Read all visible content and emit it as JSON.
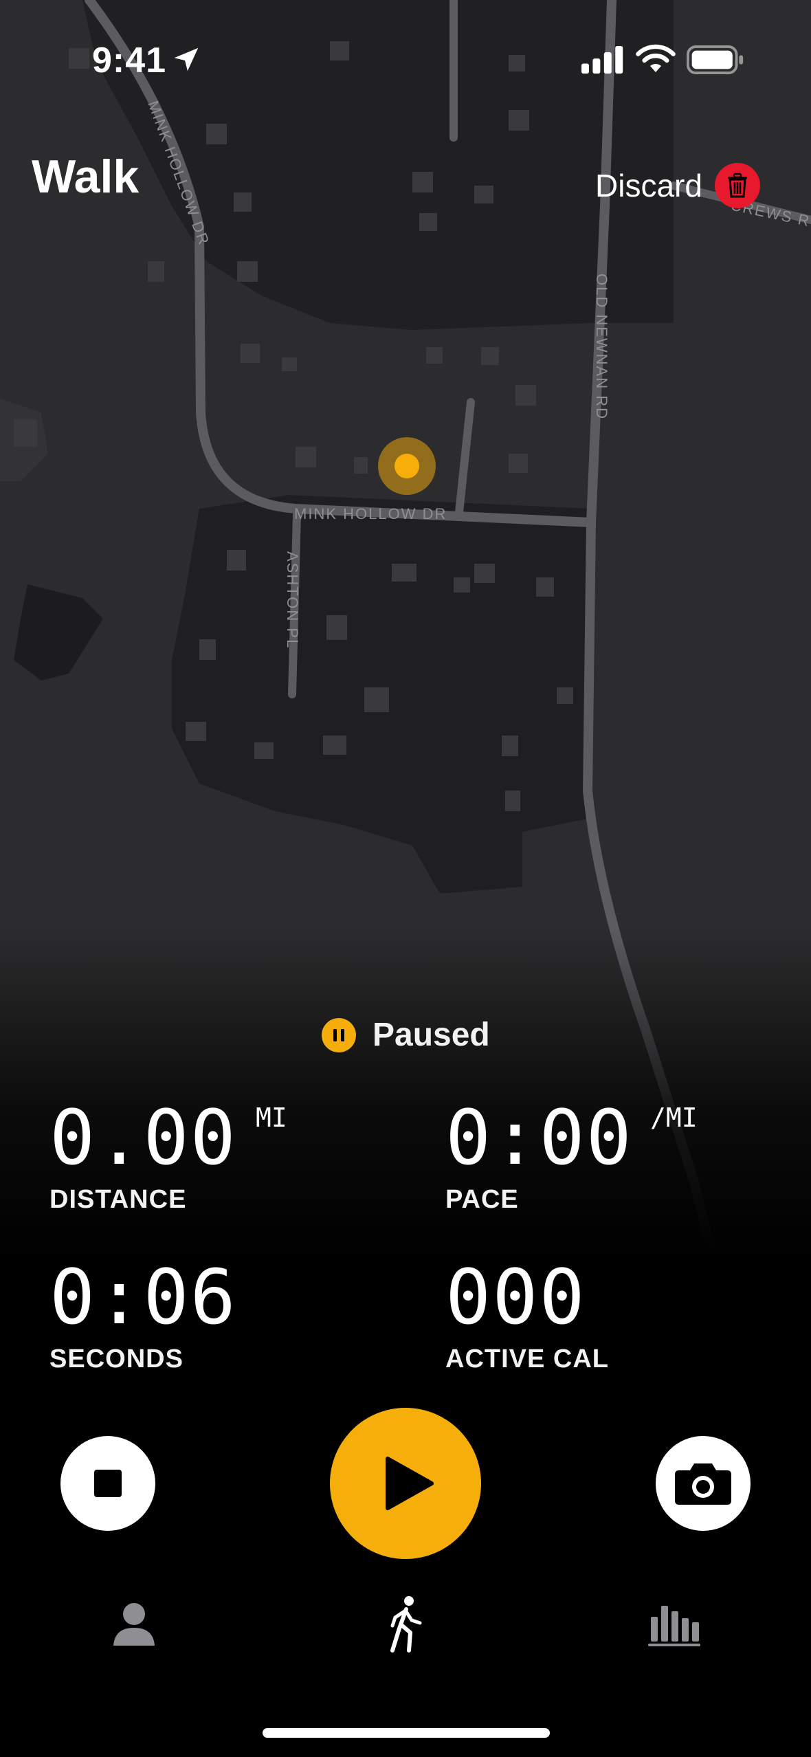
{
  "status_bar": {
    "time": "9:41"
  },
  "header": {
    "title": "Walk",
    "discard_label": "Discard"
  },
  "map": {
    "streets": [
      "MINK HOLLOW DR",
      "MINK HOLLOW DR",
      "ASHTON PL",
      "OLD NEWNAN RD",
      "CREWS R"
    ]
  },
  "workout": {
    "state_label": "Paused",
    "metrics": [
      {
        "value": "0.00",
        "unit": "MI",
        "label": "DISTANCE"
      },
      {
        "value": "0:00",
        "unit": "/MI",
        "label": "PACE"
      },
      {
        "value": "0:06",
        "unit": "",
        "label": "SECONDS"
      },
      {
        "value": "000",
        "unit": "",
        "label": "ACTIVE CAL"
      }
    ]
  },
  "controls": {
    "stop_icon": "stop-icon",
    "play_icon": "play-icon",
    "camera_icon": "camera-icon"
  },
  "tab_bar": {
    "items": [
      {
        "icon": "person-icon",
        "active": false
      },
      {
        "icon": "walking-icon",
        "active": true
      },
      {
        "icon": "chart-icon",
        "active": false
      }
    ]
  },
  "colors": {
    "accent": "#f6ae0a",
    "discard": "#e8192c",
    "map_land": "#2d2d2f",
    "map_block": "#1f1f21",
    "map_road": "#5a5a5e"
  }
}
